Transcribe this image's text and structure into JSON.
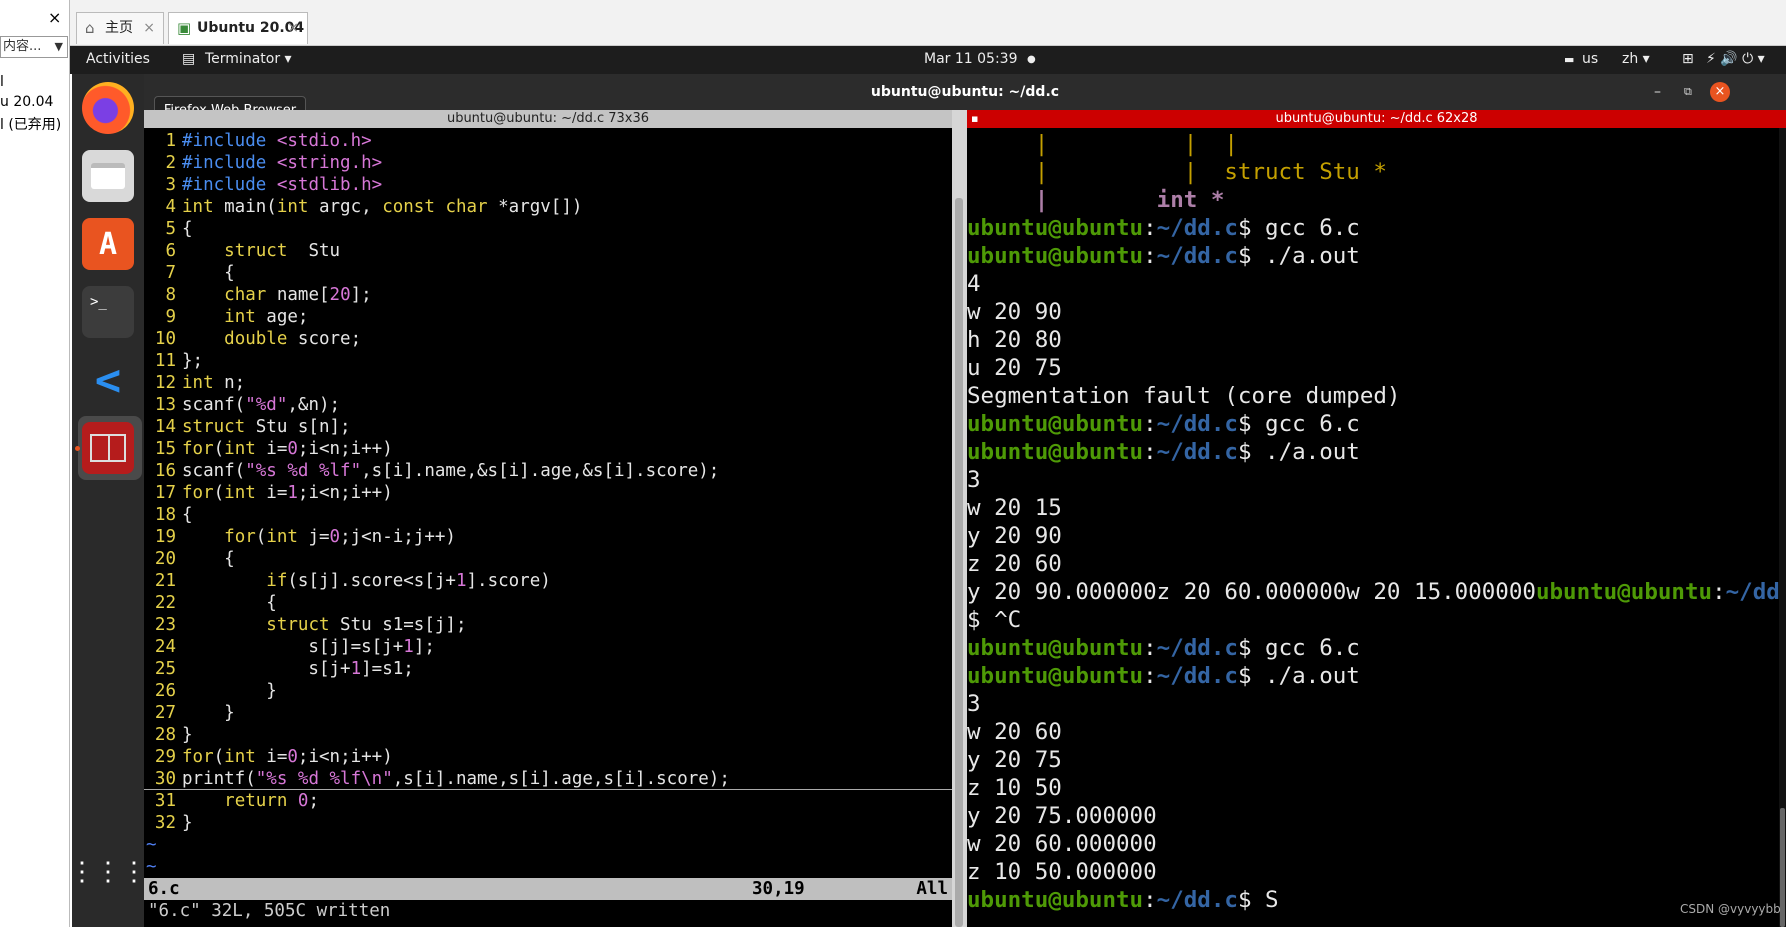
{
  "host": {
    "close_glyph": "×",
    "search_text": "内容...",
    "items": [
      "l",
      "u 20.04",
      "l (已弃用)"
    ]
  },
  "vm_tabs": [
    {
      "label": "主页",
      "icon": "home-icon"
    },
    {
      "label": "Ubuntu 20.04",
      "icon": "vm-icon"
    }
  ],
  "topbar": {
    "activities": "Activities",
    "app_menu": "Terminator ▾",
    "datetime": "Mar 11  05:39",
    "indicator": "●",
    "keyboard": "us",
    "input_method": "zh ▾",
    "system_glyphs": "⚡ 🔊 ⏻ ▾"
  },
  "dock": {
    "tooltip": "Firefox Web Browser",
    "apps": [
      "firefox-icon",
      "files-icon",
      "software-center-icon",
      "terminal-icon",
      "vscode-icon",
      "terminator-icon"
    ],
    "show_apps": "show-applications-icon"
  },
  "window": {
    "title": "ubuntu@ubuntu: ~/dd.c",
    "left_pane_title": "ubuntu@ubuntu: ~/dd.c 73x36",
    "right_pane_title": "ubuntu@ubuntu: ~/dd.c 62x28"
  },
  "vim": {
    "lines": [
      {
        "n": "1",
        "code": "#include <stdio.h>"
      },
      {
        "n": "2",
        "code": "#include <string.h>"
      },
      {
        "n": "3",
        "code": "#include <stdlib.h>"
      },
      {
        "n": "4",
        "code": "int main(int argc, const char *argv[])"
      },
      {
        "n": "5",
        "code": "{"
      },
      {
        "n": "6",
        "code": "    struct  Stu"
      },
      {
        "n": "7",
        "code": "    {"
      },
      {
        "n": "8",
        "code": "    char name[20];"
      },
      {
        "n": "9",
        "code": "    int age;"
      },
      {
        "n": "10",
        "code": "    double score;"
      },
      {
        "n": "11",
        "code": "};"
      },
      {
        "n": "12",
        "code": "int n;"
      },
      {
        "n": "13",
        "code": "scanf(\"%d\",&n);"
      },
      {
        "n": "14",
        "code": "struct Stu s[n];"
      },
      {
        "n": "15",
        "code": "for(int i=0;i<n;i++)"
      },
      {
        "n": "16",
        "code": "scanf(\"%s %d %lf\",s[i].name,&s[i].age,&s[i].score);"
      },
      {
        "n": "17",
        "code": "for(int i=1;i<n;i++)"
      },
      {
        "n": "18",
        "code": "{"
      },
      {
        "n": "19",
        "code": "    for(int j=0;j<n-i;j++)"
      },
      {
        "n": "20",
        "code": "    {"
      },
      {
        "n": "21",
        "code": "        if(s[j].score<s[j+1].score)"
      },
      {
        "n": "22",
        "code": "        {"
      },
      {
        "n": "23",
        "code": "        struct Stu s1=s[j];"
      },
      {
        "n": "24",
        "code": "            s[j]=s[j+1];"
      },
      {
        "n": "25",
        "code": "            s[j+1]=s1;"
      },
      {
        "n": "26",
        "code": "        }"
      },
      {
        "n": "27",
        "code": "    }"
      },
      {
        "n": "28",
        "code": "}"
      },
      {
        "n": "29",
        "code": "for(int i=0;i<n;i++)"
      },
      {
        "n": "30",
        "code": "printf(\"%s %d %lf\\n\",s[i].name,s[i].age,s[i].score);"
      },
      {
        "n": "31",
        "code": "    return 0;"
      },
      {
        "n": "32",
        "code": "}"
      }
    ],
    "tilde": "~",
    "status_file": "6.c",
    "status_pos": "30,19",
    "status_all": "All",
    "cmdline": "\"6.c\" 32L, 505C written"
  },
  "terminal": {
    "prompt_user": "ubuntu@ubuntu",
    "prompt_path": "~/dd.c",
    "lines": [
      {
        "type": "raw",
        "text": "     |          |  |"
      },
      {
        "type": "raw2",
        "text": "     |          |  struct Stu *"
      },
      {
        "type": "raw3",
        "text": "     |        int *"
      },
      {
        "type": "prompt",
        "cmd": " gcc 6.c"
      },
      {
        "type": "prompt",
        "cmd": " ./a.out"
      },
      {
        "type": "out",
        "text": "4"
      },
      {
        "type": "out",
        "text": "w 20 90"
      },
      {
        "type": "out",
        "text": "h 20 80"
      },
      {
        "type": "out",
        "text": "u 20 75"
      },
      {
        "type": "out",
        "text": "Segmentation fault (core dumped)"
      },
      {
        "type": "prompt",
        "cmd": " gcc 6.c"
      },
      {
        "type": "prompt",
        "cmd": " ./a.out"
      },
      {
        "type": "out",
        "text": "3"
      },
      {
        "type": "out",
        "text": "w 20 15"
      },
      {
        "type": "out",
        "text": "y 20 90"
      },
      {
        "type": "out",
        "text": "z 20 60"
      },
      {
        "type": "mixed",
        "text": "y 20 90.000000z 20 60.000000w 20 15.000000"
      },
      {
        "type": "out",
        "text": "$ ^C"
      },
      {
        "type": "prompt",
        "cmd": " gcc 6.c"
      },
      {
        "type": "prompt",
        "cmd": " ./a.out"
      },
      {
        "type": "out",
        "text": "3"
      },
      {
        "type": "out",
        "text": "w 20 60"
      },
      {
        "type": "out",
        "text": "y 20 75"
      },
      {
        "type": "out",
        "text": "z 10 50"
      },
      {
        "type": "out",
        "text": "y 20 75.000000"
      },
      {
        "type": "out",
        "text": "w 20 60.000000"
      },
      {
        "type": "out",
        "text": "z 10 50.000000"
      },
      {
        "type": "prompt",
        "cmd": " S"
      }
    ]
  },
  "watermark": "CSDN @vyvyybb",
  "colors": {
    "prompt_user": "#4e9a06",
    "prompt_path": "#3465a4",
    "line_number": "#e5d14a",
    "right_title_bg": "#cc0000"
  }
}
